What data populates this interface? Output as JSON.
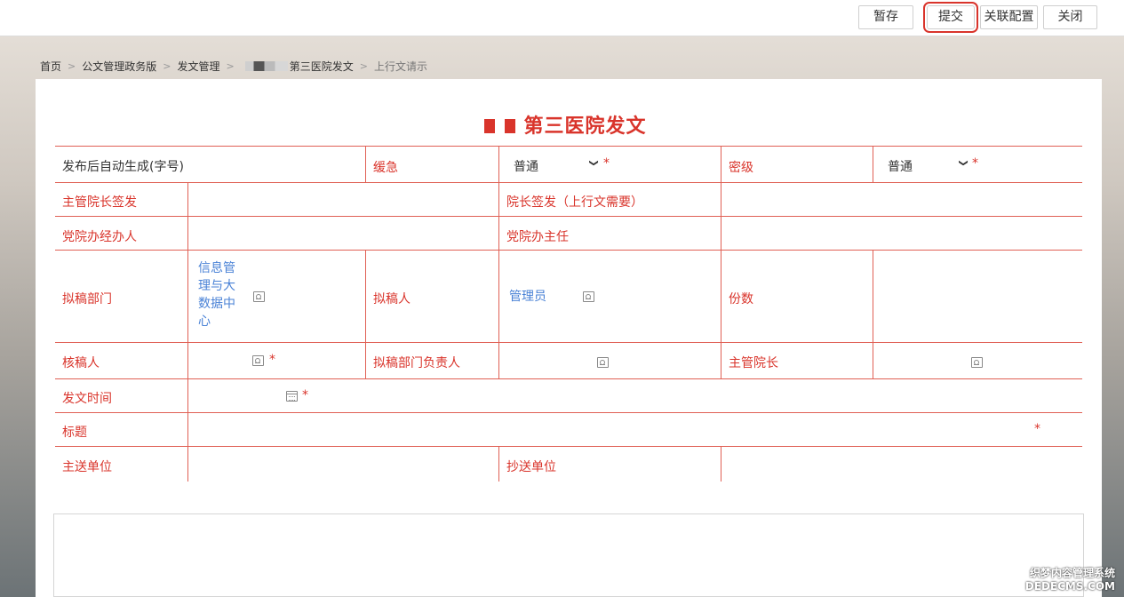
{
  "toolbar": {
    "save_draft": "暂存",
    "submit": "提交",
    "link_config": "关联配置",
    "close": "关闭"
  },
  "breadcrumb": {
    "home": "首页",
    "level1": "公文管理政务版",
    "level2": "发文管理",
    "level3": "第三医院发文",
    "current": "上行文请示"
  },
  "form": {
    "title": "第三医院发文",
    "row1": {
      "doc_number": "发布后自动生成(字号)",
      "urgency_label": "缓急",
      "urgency_value": "普通",
      "secrecy_label": "密级",
      "secrecy_value": "普通"
    },
    "row2": {
      "director_sign_label": "主管院长签发",
      "president_sign_label": "院长签发（上行文需要）"
    },
    "row3": {
      "party_office_handler_label": "党院办经办人",
      "party_office_director_label": "党院办主任"
    },
    "row4": {
      "draft_dept_label": "拟稿部门",
      "draft_dept_value": [
        "信息管",
        "理与大",
        "数据中",
        "心"
      ],
      "drafter_label": "拟稿人",
      "drafter_value": "管理员",
      "copies_label": "份数"
    },
    "row5": {
      "reviewer_label": "核稿人",
      "dept_head_label": "拟稿部门负责人",
      "vice_president_label": "主管院长"
    },
    "row6": {
      "issue_time_label": "发文时间"
    },
    "row7": {
      "subject_label": "标题"
    },
    "row8": {
      "main_recipient_label": "主送单位",
      "cc_recipient_label": "抄送单位"
    },
    "required_mark": "*"
  },
  "watermark": {
    "line1": "织梦内容管理系统",
    "line2": "DEDECMS.COM"
  },
  "colors": {
    "accent_red": "#d9342b",
    "link_blue": "#4a82d6",
    "grid_line": "#e06055"
  },
  "icons": [
    "chevron-down-icon",
    "user-picker-icon",
    "calendar-icon"
  ]
}
